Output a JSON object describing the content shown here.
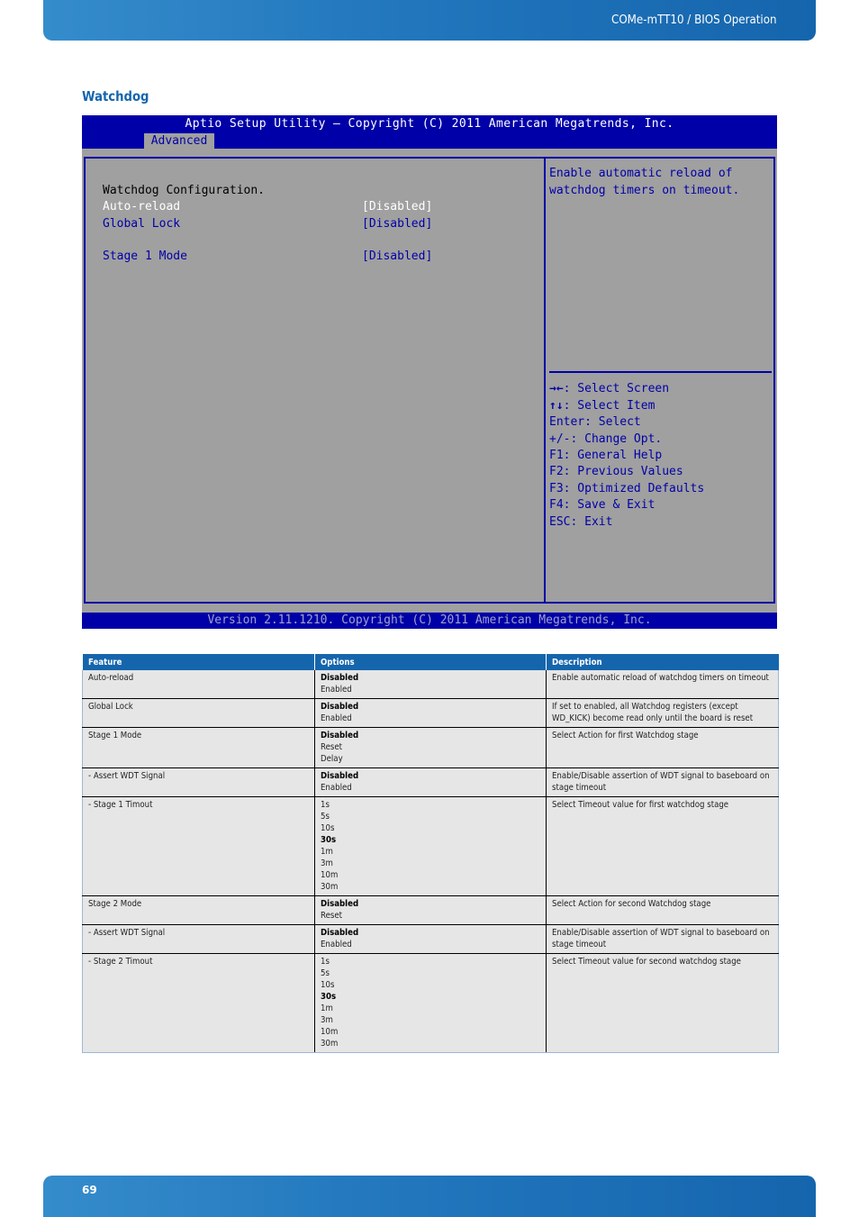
{
  "header": {
    "title": "COMe-mTT10 / BIOS Operation"
  },
  "section": {
    "title": "Watchdog"
  },
  "bios": {
    "title": "Aptio Setup Utility – Copyright (C) 2011 American Megatrends, Inc.",
    "active_tab": "Advanced",
    "config_heading": "Watchdog Configuration.",
    "items": [
      {
        "label": "Auto-reload",
        "value": "[Disabled]",
        "selected": true
      },
      {
        "label": "Global Lock",
        "value": "[Disabled]",
        "selected": false
      },
      {
        "label": "Stage 1 Mode",
        "value": "[Disabled]",
        "selected": false
      }
    ],
    "help_text": [
      "Enable automatic reload of",
      "watchdog timers on timeout."
    ],
    "key_help": [
      {
        "key": "→←",
        "text": ": Select Screen"
      },
      {
        "key": "↑↓",
        "text": ": Select Item"
      },
      {
        "key": "",
        "text": "Enter: Select"
      },
      {
        "key": "",
        "text": "+/-: Change Opt."
      },
      {
        "key": "",
        "text": "F1: General Help"
      },
      {
        "key": "",
        "text": "F2: Previous Values"
      },
      {
        "key": "",
        "text": "F3: Optimized Defaults"
      },
      {
        "key": "",
        "text": "F4: Save & Exit"
      },
      {
        "key": "",
        "text": "ESC: Exit"
      }
    ],
    "version": "Version 2.11.1210. Copyright (C) 2011 American Megatrends, Inc."
  },
  "table": {
    "headers": [
      "Feature",
      "Options",
      "Description"
    ],
    "rows": [
      {
        "feature": "Auto-reload",
        "options": [
          "Disabled",
          "Enabled"
        ],
        "default": "Disabled",
        "description": "Enable automatic reload of watchdog timers on timeout"
      },
      {
        "feature": "Global Lock",
        "options": [
          "Disabled",
          "Enabled"
        ],
        "default": "Disabled",
        "description": "If set to enabled, all Watchdog registers (except WD_KICK) become read only until the board is reset"
      },
      {
        "feature": "Stage 1 Mode",
        "options": [
          "Disabled",
          "Reset",
          "Delay"
        ],
        "default": "Disabled",
        "description": "Select Action for first Watchdog stage"
      },
      {
        "feature": "- Assert WDT Signal",
        "options": [
          "Disabled",
          "Enabled"
        ],
        "default": "Disabled",
        "description": "Enable/Disable assertion of WDT signal to baseboard on stage timeout"
      },
      {
        "feature": "- Stage 1 Timout",
        "options": [
          "1s",
          "5s",
          "10s",
          "30s",
          "1m",
          "3m",
          "10m",
          "30m"
        ],
        "default": "30s",
        "description": "Select Timeout value for first watchdog stage"
      },
      {
        "feature": "Stage 2 Mode",
        "options": [
          "Disabled",
          "Reset"
        ],
        "default": "Disabled",
        "description": "Select Action for second Watchdog stage"
      },
      {
        "feature": "- Assert WDT Signal",
        "options": [
          "Disabled",
          "Enabled"
        ],
        "default": "Disabled",
        "description": "Enable/Disable assertion of WDT signal to baseboard on stage timeout"
      },
      {
        "feature": "- Stage 2 Timout",
        "options": [
          "1s",
          "5s",
          "10s",
          "30s",
          "1m",
          "3m",
          "10m",
          "30m"
        ],
        "default": "30s",
        "description": "Select Timeout value for second watchdog stage"
      }
    ]
  },
  "footer": {
    "page_number": "69"
  }
}
